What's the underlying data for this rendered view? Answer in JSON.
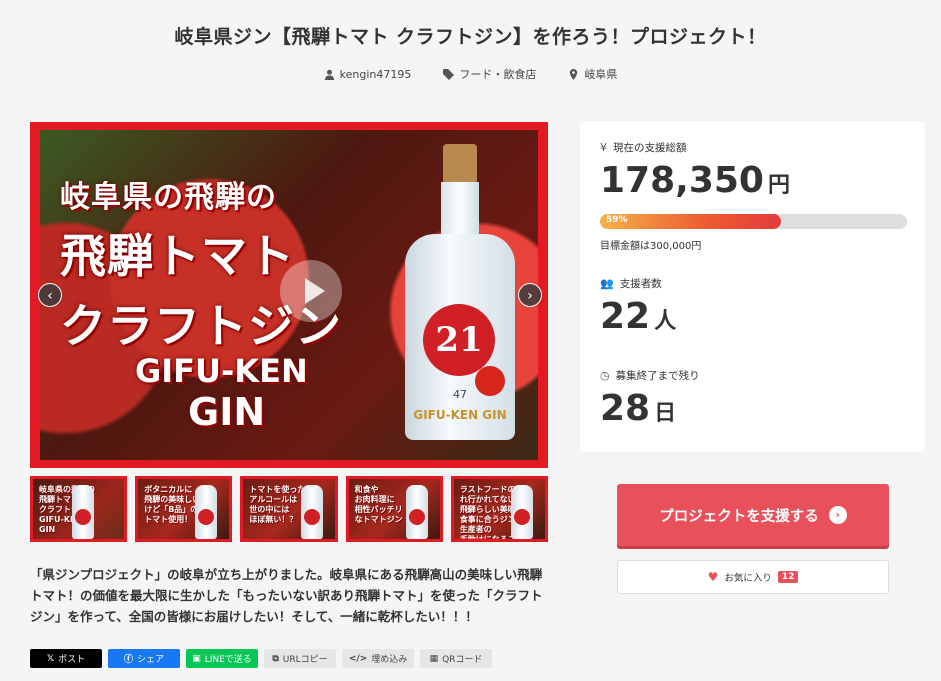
{
  "page": {
    "title": "岐阜県ジン【飛騨トマト クラフトジン】を作ろう！プロジェクト！",
    "meta": {
      "user": "kengin47195",
      "category": "フード・飲食店",
      "location": "岐阜県"
    }
  },
  "hero": {
    "lines": [
      "岐阜県の飛騨の",
      "飛騨トマト",
      "クラフトジン",
      "GIFU-KEN",
      "GIN"
    ],
    "bottle_number": "21",
    "bottle_sub": "47",
    "bottle_gin": "GIFU-KEN GIN"
  },
  "thumbnails": [
    {
      "text": "岐阜県の飛騨の\n飛騨トマト\nクラフトジン\nGIFU-KEN\nGIN"
    },
    {
      "text": "ボタニカルに\n飛騨の美味しい\nけど「B品」の\nトマト使用！"
    },
    {
      "text": "トマトを使った\nアルコールは\n世の中には\nほぼ無い！？"
    },
    {
      "text": "和食や\nお肉料理に\n相性バッチリ\nなトマトジン"
    },
    {
      "text": "ラストフードのから\nれ行かれてない\n飛騨らしい美味で\n食事に合うジン\n生産者の\n手助けになること"
    }
  ],
  "description": "「県ジンプロジェクト」の岐阜が立ち上がりました。岐阜県にある飛騨高山の美味しい飛騨トマト！の価値を最大限に生かした「もったいない訳あり飛騨トマト」を使った「クラフトジン」を作って、全国の皆様にお届けしたい！そして、一緒に乾杯したい！！！",
  "share": {
    "x": "ポスト",
    "facebook": "シェア",
    "line": "LINEで送る",
    "url": "URLコピー",
    "embed": "埋め込み",
    "qr": "QRコード"
  },
  "stats": {
    "funding_label": "現在の支援総額",
    "funding_amount": "178,350",
    "currency": "円",
    "progress_percent": 59,
    "progress_text": "59%",
    "goal_text": "目標金額は300,000円",
    "supporters_label": "支援者数",
    "supporters_count": "22",
    "supporters_unit": "人",
    "remaining_label": "募集終了まで残り",
    "remaining_count": "28",
    "remaining_unit": "日"
  },
  "actions": {
    "support_button": "プロジェクトを支援する",
    "favorite_label": "お気に入り",
    "favorite_count": "12"
  },
  "colors": {
    "accent": "#e8505b",
    "hero_frame": "#e21a24"
  }
}
